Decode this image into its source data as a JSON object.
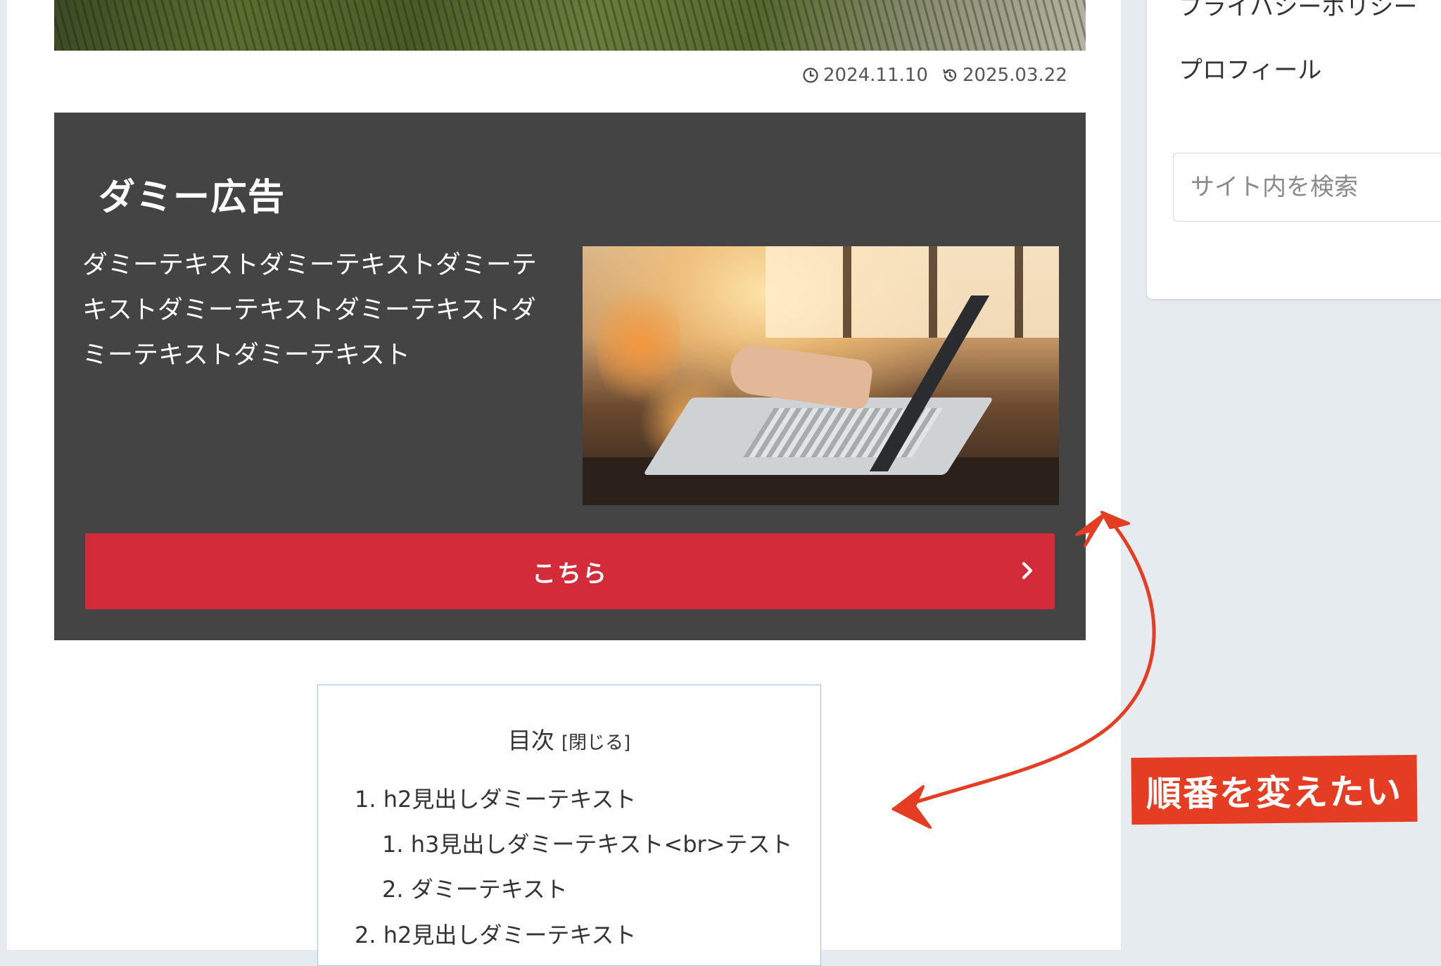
{
  "dates": {
    "published": "2024.11.10",
    "updated": "2025.03.22"
  },
  "ad": {
    "title": "ダミー広告",
    "text": "ダミーテキストダミーテキストダミーテキストダミーテキストダミーテキストダミーテキストダミーテキスト",
    "button_label": "こちら"
  },
  "toc": {
    "title": "目次",
    "toggle": "[閉じる]",
    "items": [
      "1. h2見出しダミーテキスト",
      "1. h3見出しダミーテキスト<br>テスト",
      "2. ダミーテキスト",
      "2. h2見出しダミーテキスト"
    ]
  },
  "sidebar": {
    "links": [
      "プライバシーポリシー",
      "プロフィール"
    ],
    "search_placeholder": "サイト内を検索"
  },
  "annotation": {
    "label": "順番を変えたい",
    "color": "#e43d24"
  },
  "colors": {
    "ad_background": "#444444",
    "button": "#d42b3a",
    "toc_border": "#9cc7e3",
    "page_background": "#e6ebf0"
  }
}
